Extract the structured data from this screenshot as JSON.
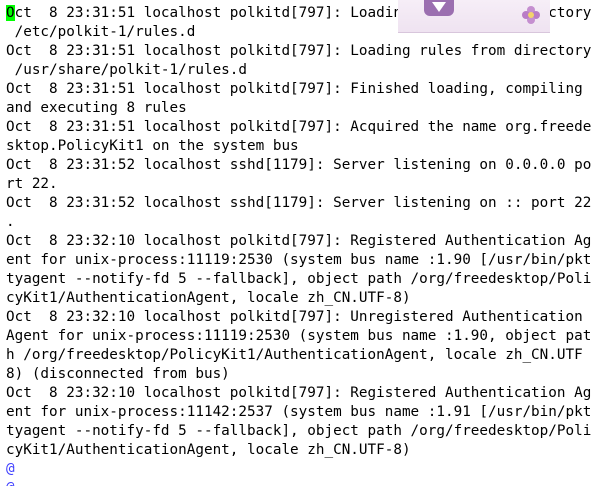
{
  "terminal": {
    "lines": [
      "Oct  8 23:31:51 localhost polkitd[797]: Loading rules from directory",
      " /etc/polkit-1/rules.d",
      "Oct  8 23:31:51 localhost polkitd[797]: Loading rules from directory",
      " /usr/share/polkit-1/rules.d",
      "Oct  8 23:31:51 localhost polkitd[797]: Finished loading, compiling",
      "and executing 8 rules",
      "Oct  8 23:31:51 localhost polkitd[797]: Acquired the name org.freede",
      "sktop.PolicyKit1 on the system bus",
      "Oct  8 23:31:52 localhost sshd[1179]: Server listening on 0.0.0.0 po",
      "rt 22.",
      "Oct  8 23:31:52 localhost sshd[1179]: Server listening on :: port 22",
      ".",
      "Oct  8 23:32:10 localhost polkitd[797]: Registered Authentication Ag",
      "ent for unix-process:11119:2530 (system bus name :1.90 [/usr/bin/pkt",
      "tyagent --notify-fd 5 --fallback], object path /org/freedesktop/Poli",
      "cyKit1/AuthenticationAgent, locale zh_CN.UTF-8)",
      "Oct  8 23:32:10 localhost polkitd[797]: Unregistered Authentication",
      "Agent for unix-process:11119:2530 (system bus name :1.90, object pat",
      "h /org/freedesktop/PolicyKit1/AuthenticationAgent, locale zh_CN.UTF",
      "8) (disconnected from bus)",
      "Oct  8 23:32:10 localhost polkitd[797]: Registered Authentication Ag",
      "ent for unix-process:11142:2537 (system bus name :1.91 [/usr/bin/pkt",
      "tyagent --notify-fd 5 --fallback], object path /org/freedesktop/Poli",
      "cyKit1/AuthenticationAgent, locale zh_CN.UTF-8)"
    ],
    "cursor_char": "O",
    "trailing_prompt": "@",
    "trailing_prompt_2": "@"
  },
  "colors": {
    "background": "#ffffff",
    "text": "#000000",
    "cursor": "#00ff00",
    "prompt": "#3f3fff"
  }
}
